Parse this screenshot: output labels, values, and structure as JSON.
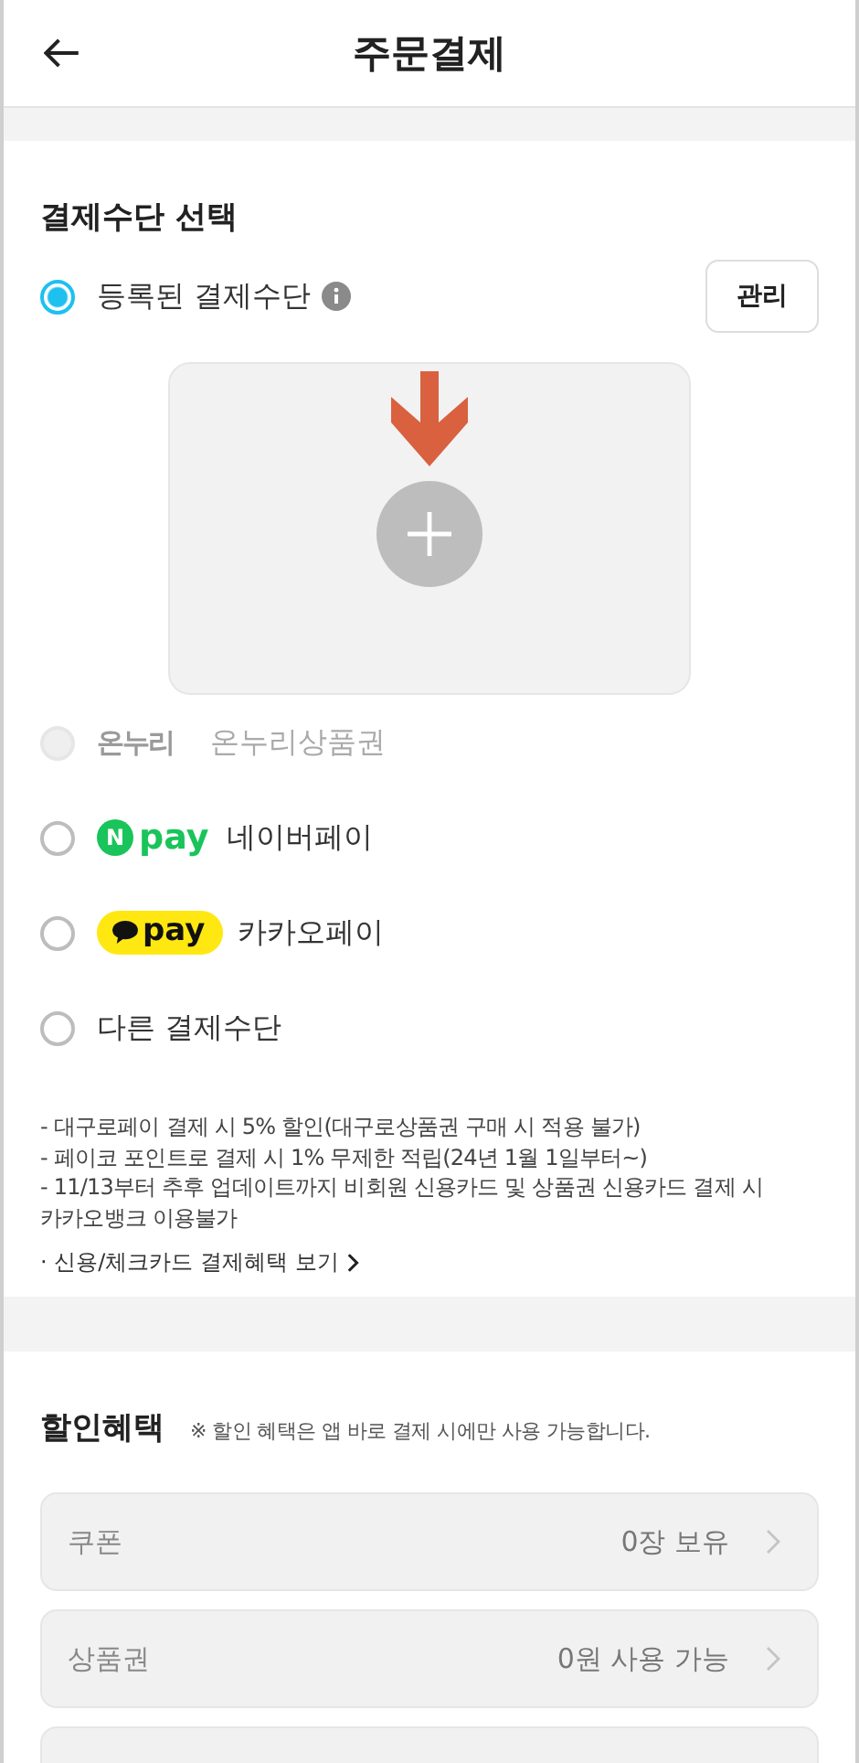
{
  "header": {
    "title": "주문결제"
  },
  "payment": {
    "title": "결제수단 선택",
    "registered": {
      "label": "등록된 결제수단",
      "selected": true,
      "manage_button": "관리"
    },
    "options": [
      {
        "kind": "onnuri",
        "logo_text": "온누리",
        "label": "온누리상품권",
        "selected": false,
        "disabled": true
      },
      {
        "kind": "npay",
        "badge_text": "N",
        "logo_text": "pay",
        "label": "네이버페이",
        "selected": false,
        "disabled": false
      },
      {
        "kind": "kakaopay",
        "logo_text": "pay",
        "label": "카카오페이",
        "selected": false,
        "disabled": false
      },
      {
        "kind": "plain",
        "label": "다른 결제수단",
        "selected": false,
        "disabled": false
      }
    ],
    "notes": [
      "- 대구로페이 결제 시 5% 할인(대구로상품권 구매 시 적용 불가)",
      "- 페이코 포인트로 결제 시 1% 무제한 적립(24년 1월 1일부터~)",
      "- 11/13부터 추후 업데이트까지 비회원 신용카드 및 상품권 신용카드 결제 시 카카오뱅크 이용불가"
    ],
    "benefit_link": "· 신용/체크카드 결제혜택 보기"
  },
  "discount": {
    "title": "할인혜택",
    "note": "※ 할인 혜택은 앱 바로 결제 시에만 사용 가능합니다.",
    "rows": [
      {
        "label": "쿠폰",
        "value": "0장 보유"
      },
      {
        "label": "상품권",
        "value": "0원 사용 가능"
      }
    ]
  }
}
